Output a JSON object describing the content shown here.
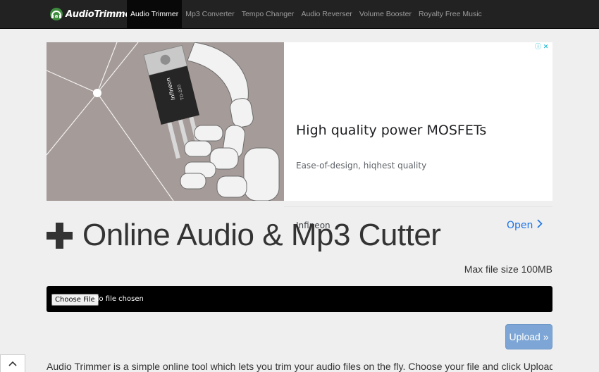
{
  "brand": {
    "name": "AudioTrimmer",
    "icon": "headphones-logo-icon",
    "accent": "#4caf50"
  },
  "nav": {
    "items": [
      {
        "label": "Audio Trimmer",
        "active": true
      },
      {
        "label": "Mp3 Converter",
        "active": false
      },
      {
        "label": "Tempo Changer",
        "active": false
      },
      {
        "label": "Audio Reverser",
        "active": false
      },
      {
        "label": "Volume Booster",
        "active": false
      },
      {
        "label": "Royalty Free Music",
        "active": false
      }
    ]
  },
  "ad": {
    "headline": "High quality power MOSFETs",
    "description": "Ease-of-design, hiqhest quality",
    "advertiser": "Infineon",
    "cta": "Open",
    "chip_label": "Infineon",
    "chip_model": "TO-220",
    "info_icon": "ad-info-icon",
    "close_icon": "ad-close-icon"
  },
  "main": {
    "title": "Online Audio & Mp3 Cutter",
    "max_size": "Max file size 100MB",
    "choose_file": "Choose File",
    "no_file": "No file chosen",
    "upload": "Upload »",
    "description": "Audio Trimmer is a simple online tool which lets you trim your audio files on the fly. Choose your file and click Upload to get"
  },
  "colors": {
    "navbar": "#222222",
    "upload": "#7da6d6",
    "file_bar": "#000000"
  }
}
